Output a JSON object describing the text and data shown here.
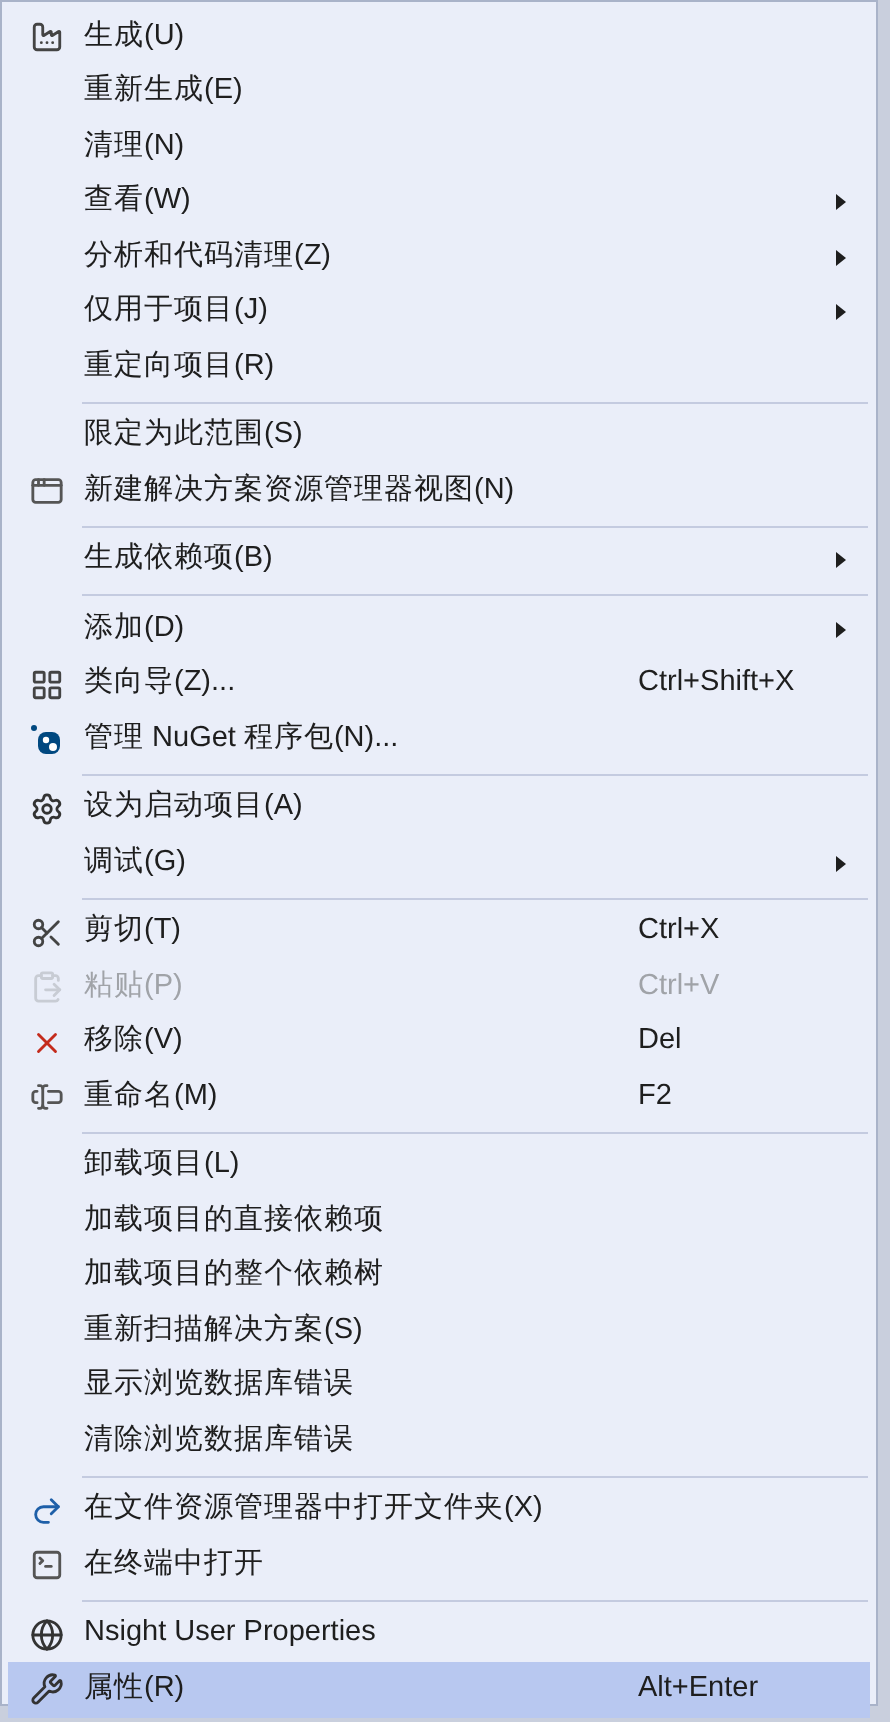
{
  "menu": {
    "sections": [
      {
        "items": [
          {
            "label": "生成(U)",
            "submenu": false,
            "disabled": false,
            "selected": false
          },
          {
            "label": "重新生成(E)",
            "submenu": false,
            "disabled": false,
            "selected": false
          },
          {
            "label": "清理(N)",
            "submenu": false,
            "disabled": false,
            "selected": false
          },
          {
            "label": "查看(W)",
            "submenu": true,
            "disabled": false,
            "selected": false
          },
          {
            "label": "分析和代码清理(Z)",
            "submenu": true,
            "disabled": false,
            "selected": false
          },
          {
            "label": "仅用于项目(J)",
            "submenu": true,
            "disabled": false,
            "selected": false
          },
          {
            "label": "重定向项目(R)",
            "submenu": false,
            "disabled": false,
            "selected": false
          }
        ]
      },
      {
        "items": [
          {
            "label": "限定为此范围(S)",
            "submenu": false,
            "disabled": false,
            "selected": false
          },
          {
            "label": "新建解决方案资源管理器视图(N)",
            "submenu": false,
            "disabled": false,
            "selected": false
          }
        ]
      },
      {
        "items": [
          {
            "label": "生成依赖项(B)",
            "submenu": true,
            "disabled": false,
            "selected": false
          }
        ]
      },
      {
        "items": [
          {
            "label": "添加(D)",
            "submenu": true,
            "disabled": false,
            "selected": false
          },
          {
            "label": "类向导(Z)...",
            "shortcut": "Ctrl+Shift+X",
            "submenu": false,
            "disabled": false,
            "selected": false
          },
          {
            "label": "管理 NuGet 程序包(N)...",
            "submenu": false,
            "disabled": false,
            "selected": false
          }
        ]
      },
      {
        "items": [
          {
            "label": "设为启动项目(A)",
            "submenu": false,
            "disabled": false,
            "selected": false
          },
          {
            "label": "调试(G)",
            "submenu": true,
            "disabled": false,
            "selected": false
          }
        ]
      },
      {
        "items": [
          {
            "label": "剪切(T)",
            "shortcut": "Ctrl+X",
            "submenu": false,
            "disabled": false,
            "selected": false
          },
          {
            "label": "粘贴(P)",
            "shortcut": "Ctrl+V",
            "submenu": false,
            "disabled": true,
            "selected": false
          },
          {
            "label": "移除(V)",
            "shortcut": "Del",
            "submenu": false,
            "disabled": false,
            "selected": false
          },
          {
            "label": "重命名(M)",
            "shortcut": "F2",
            "submenu": false,
            "disabled": false,
            "selected": false
          }
        ]
      },
      {
        "items": [
          {
            "label": "卸载项目(L)",
            "submenu": false,
            "disabled": false,
            "selected": false
          },
          {
            "label": "加载项目的直接依赖项",
            "submenu": false,
            "disabled": false,
            "selected": false
          },
          {
            "label": "加载项目的整个依赖树",
            "submenu": false,
            "disabled": false,
            "selected": false
          },
          {
            "label": "重新扫描解决方案(S)",
            "submenu": false,
            "disabled": false,
            "selected": false
          },
          {
            "label": "显示浏览数据库错误",
            "submenu": false,
            "disabled": false,
            "selected": false
          },
          {
            "label": "清除浏览数据库错误",
            "submenu": false,
            "disabled": false,
            "selected": false
          }
        ]
      },
      {
        "items": [
          {
            "label": "在文件资源管理器中打开文件夹(X)",
            "submenu": false,
            "disabled": false,
            "selected": false
          },
          {
            "label": "在终端中打开",
            "submenu": false,
            "disabled": false,
            "selected": false
          }
        ]
      },
      {
        "items": [
          {
            "label": "Nsight User Properties",
            "submenu": false,
            "disabled": false,
            "selected": false
          },
          {
            "label": "属性(R)",
            "shortcut": "Alt+Enter",
            "submenu": false,
            "disabled": false,
            "selected": true
          }
        ]
      }
    ]
  }
}
